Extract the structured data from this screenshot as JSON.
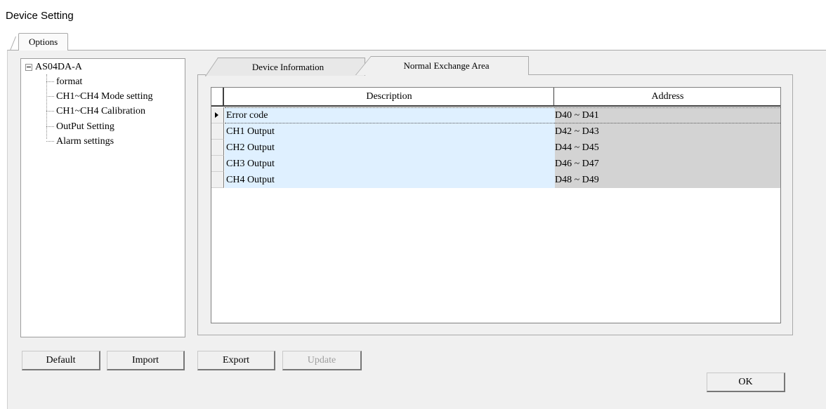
{
  "window": {
    "title": "Device Setting"
  },
  "outer_tab": {
    "label": "Options"
  },
  "tree": {
    "root": {
      "label": "AS04DA-A",
      "expanded": true
    },
    "items": [
      {
        "label": "format"
      },
      {
        "label": "CH1~CH4 Mode setting"
      },
      {
        "label": "CH1~CH4 Calibration"
      },
      {
        "label": "OutPut Setting"
      },
      {
        "label": "Alarm settings"
      }
    ]
  },
  "tabs": [
    {
      "label": "Device Information",
      "active": false
    },
    {
      "label": "Normal Exchange Area",
      "active": true
    }
  ],
  "grid": {
    "columns": {
      "description": "Description",
      "address": "Address"
    },
    "rows": [
      {
        "description": "Error code",
        "address": "D40 ~ D41",
        "selected": true
      },
      {
        "description": "CH1 Output",
        "address": "D42 ~ D43",
        "selected": false
      },
      {
        "description": "CH2 Output",
        "address": "D44 ~ D45",
        "selected": false
      },
      {
        "description": "CH3 Output",
        "address": "D46 ~ D47",
        "selected": false
      },
      {
        "description": "CH4 Output",
        "address": "D48 ~ D49",
        "selected": false
      }
    ]
  },
  "buttons": {
    "default": "Default",
    "import": "Import",
    "export": "Export",
    "update": "Update",
    "ok": "OK"
  },
  "colors": {
    "description_cell_bg": "#dff0ff",
    "address_cell_bg": "#d3d3d3",
    "panel_bg": "#f0f0f0"
  }
}
